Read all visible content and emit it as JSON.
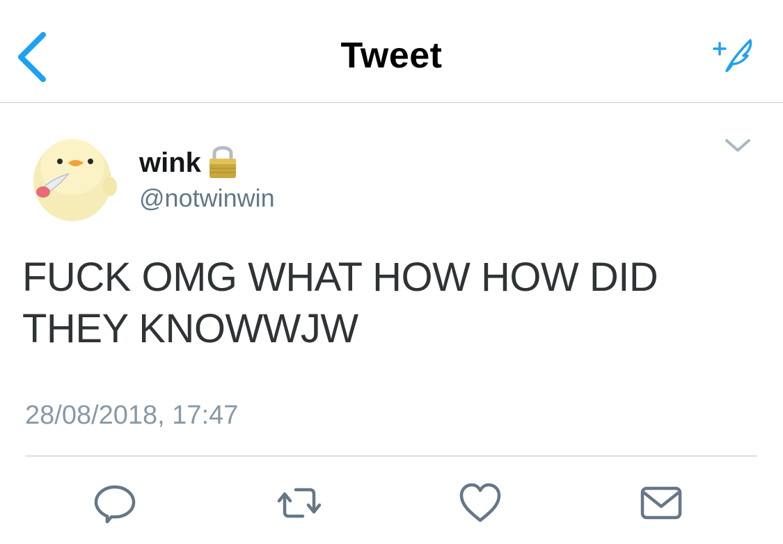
{
  "navbar": {
    "back_icon": "chevron-left-icon",
    "title": "Tweet",
    "compose_icon": "compose-sparkle-feather-icon"
  },
  "tweet": {
    "author": {
      "display_name": "wink",
      "protected_icon": "lock-icon",
      "handle": "@notwinwin",
      "avatar": "duck-with-knife-avatar"
    },
    "menu_icon": "chevron-down-icon",
    "text": "FUCK OMG WHAT HOW HOW DID\nTHEY KNOWWJW",
    "timestamp": "28/08/2018, 17:47"
  },
  "actions": [
    {
      "name": "reply",
      "icon": "reply-icon"
    },
    {
      "name": "retweet",
      "icon": "retweet-icon"
    },
    {
      "name": "like",
      "icon": "heart-icon"
    },
    {
      "name": "share",
      "icon": "mail-icon"
    }
  ],
  "colors": {
    "accent": "#1da1f2",
    "text_primary": "#14171a",
    "text_secondary": "#657786",
    "timestamp": "#8899a6",
    "icon_gray": "#657786"
  }
}
